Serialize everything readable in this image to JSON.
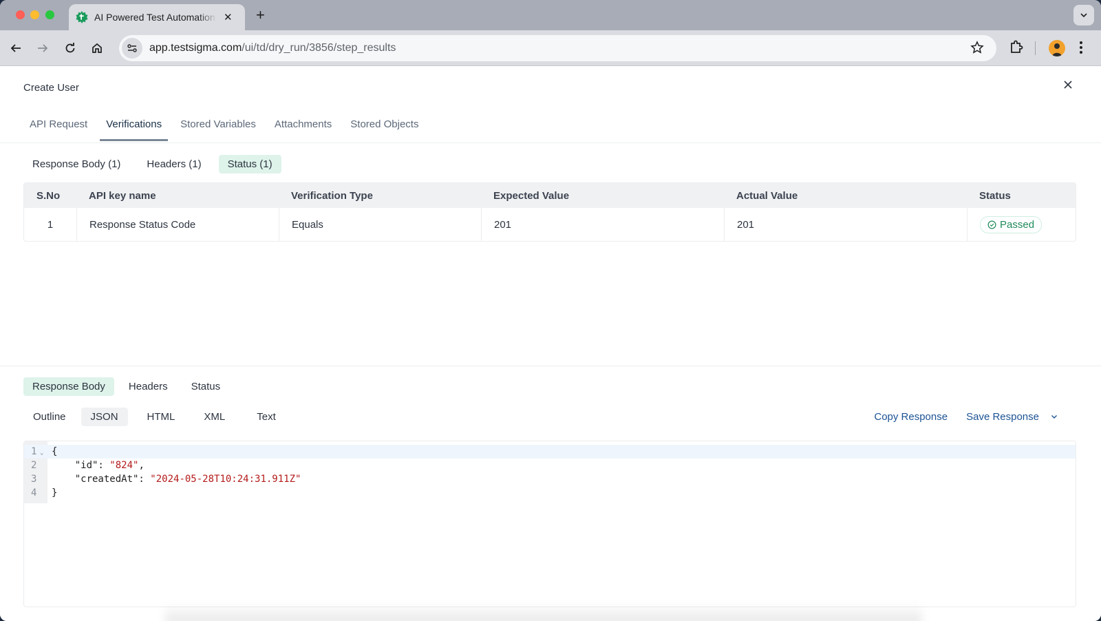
{
  "browser": {
    "tab_title": "AI Powered Test Automation Platform",
    "new_tab_label": "+",
    "url_host": "app.testsigma.com",
    "url_path": "/ui/td/dry_run/3856/step_results",
    "icons": {
      "back": "arrow-left-icon",
      "forward": "arrow-right-icon",
      "reload": "reload-icon",
      "home": "home-icon",
      "site_settings": "tune-icon",
      "bookmark": "star-icon",
      "extensions": "puzzle-icon",
      "profile": "avatar",
      "menu": "kebab-icon"
    }
  },
  "panel": {
    "title": "Create User",
    "tabs": [
      {
        "label": "API Request",
        "active": false
      },
      {
        "label": "Verifications",
        "active": true
      },
      {
        "label": "Stored Variables",
        "active": false
      },
      {
        "label": "Attachments",
        "active": false
      },
      {
        "label": "Stored Objects",
        "active": false
      }
    ],
    "sub_tabs": [
      {
        "label": "Response Body (1)",
        "active": false
      },
      {
        "label": "Headers (1)",
        "active": false
      },
      {
        "label": "Status (1)",
        "active": true
      }
    ]
  },
  "verifications_table": {
    "columns": [
      "S.No",
      "API key name",
      "Verification Type",
      "Expected Value",
      "Actual Value",
      "Status"
    ],
    "rows": [
      {
        "sno": "1",
        "api_key_name": "Response Status Code",
        "verification_type": "Equals",
        "expected": "201",
        "actual": "201",
        "status": "Passed"
      }
    ],
    "status_color": "#1f8a5b"
  },
  "response": {
    "tabs": [
      {
        "label": "Response Body",
        "active": true
      },
      {
        "label": "Headers",
        "active": false
      },
      {
        "label": "Status",
        "active": false
      }
    ],
    "formats": [
      {
        "label": "Outline",
        "active": false
      },
      {
        "label": "JSON",
        "active": true
      },
      {
        "label": "HTML",
        "active": false
      },
      {
        "label": "XML",
        "active": false
      },
      {
        "label": "Text",
        "active": false
      }
    ],
    "copy_label": "Copy Response",
    "save_label": "Save Response",
    "code_lines": [
      {
        "n": "1",
        "text": "{"
      },
      {
        "n": "2",
        "key": "    \"id\": ",
        "value": "\"824\"",
        "tail": ","
      },
      {
        "n": "3",
        "key": "    \"createdAt\": ",
        "value": "\"2024-05-28T10:24:31.911Z\"",
        "tail": ""
      },
      {
        "n": "4",
        "text": "}"
      }
    ]
  },
  "colors": {
    "accent_green_bg": "#def3ea",
    "link_blue": "#1c5394",
    "json_string": "#b51a1a"
  }
}
